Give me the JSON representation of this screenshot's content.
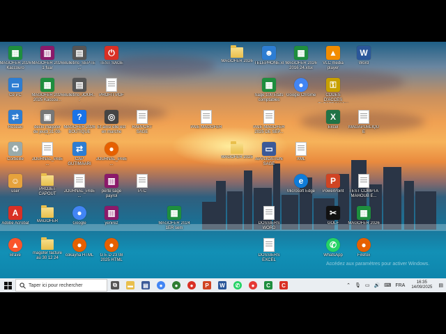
{
  "desktop": {
    "icons": [
      {
        "label": "MAGOFER 2026 Kaccouro",
        "kind": "sheet",
        "color": "#1e8e3e"
      },
      {
        "label": "MAGOFER 2026 1 fuar",
        "kind": "rar",
        "color": "#8b1a6a"
      },
      {
        "label": "Bulletins_SEPTE...",
        "kind": "file",
        "color": "#555"
      },
      {
        "label": "TEST SAGE",
        "kind": "app",
        "color": "#d93025"
      },
      {
        "label": "Ce PC",
        "kind": "pc",
        "color": "#2d7dd2"
      },
      {
        "label": "MAGOFER 2026 2025 Kaccou...",
        "kind": "sheet",
        "color": "#1e8e3e"
      },
      {
        "label": "Bulletins_JOUR...",
        "kind": "file",
        "color": "#555"
      },
      {
        "label": "PROFIT PDF",
        "kind": "doc",
        "color": "#aaa"
      },
      {
        "label": "Réseau",
        "kind": "net",
        "color": "#2d7dd2"
      },
      {
        "label": "déclo magofer de jeudi 31-09-26",
        "kind": "printer",
        "color": "#777"
      },
      {
        "label": "MAGOFER 2026 BOUTIQUE",
        "kind": "help",
        "color": "#1a73e8"
      },
      {
        "label": "Et ainsi elle est en marche",
        "kind": "app2",
        "color": "#444"
      },
      {
        "label": "RAPPORT SAGE",
        "kind": "doc",
        "color": "#aaa"
      },
      {
        "label": "Corbeille",
        "kind": "bin",
        "color": "#9aa"
      },
      {
        "label": "JOURNAL_PAIE...",
        "kind": "doc",
        "color": "#aaa"
      },
      {
        "label": "CAP GUTIMAARI",
        "kind": "net",
        "color": "#2d7dd2"
      },
      {
        "label": "JOURNAL_PAIE...",
        "kind": "firefox",
        "color": "#e66000"
      },
      {
        "label": "user",
        "kind": "user",
        "color": "#e6a23c"
      },
      {
        "label": "PROJET CAPOUT",
        "kind": "folder",
        "color": "#e9bf4c"
      },
      {
        "label": "JOURNAL_PAIE...",
        "kind": "doc",
        "color": "#aaa"
      },
      {
        "label": "perte sage payrol",
        "kind": "rar",
        "color": "#8b1a6a"
      },
      {
        "label": "PTC",
        "kind": "doc",
        "color": "#aaa"
      },
      {
        "label": "Adobe Acrobat",
        "kind": "pdf",
        "color": "#d93025"
      },
      {
        "label": "MAGOFER",
        "kind": "folder",
        "color": "#e9bf4c"
      },
      {
        "label": "Google",
        "kind": "chrome",
        "color": "#4285f4"
      },
      {
        "label": "yenirez",
        "kind": "rar",
        "color": "#8b1a6a"
      },
      {
        "label": "MAGOFER 2024 1ER sem",
        "kind": "sheet",
        "color": "#1e8e3e"
      },
      {
        "label": "Brave",
        "kind": "brave",
        "color": "#fb542b"
      },
      {
        "label": "magofer facture au 30 12 24",
        "kind": "folder",
        "color": "#e9bf4c"
      },
      {
        "label": "cokayna HTML",
        "kind": "firefox",
        "color": "#e66000"
      },
      {
        "label": "G E D 23 08 2025 HTML",
        "kind": "firefox",
        "color": "#e66000"
      },
      {
        "label": "MAGOFER 2026",
        "kind": "folder",
        "color": "#e9bf4c"
      },
      {
        "label": "TELEPHONE.xl",
        "kind": "people",
        "color": "#2d7dd2"
      },
      {
        "label": "MAGOFER 2026 2016 24.xlsx",
        "kind": "sheet",
        "color": "#1e8e3e"
      },
      {
        "label": "VLC media player",
        "kind": "vlc",
        "color": "#f28c00"
      },
      {
        "label": "Word",
        "kind": "word",
        "color": "#2b579a"
      },
      {
        "label": "Sage 100 Etats comptables",
        "kind": "sage",
        "color": "#1e8e3e"
      },
      {
        "label": "Google Chrome",
        "kind": "chrome",
        "color": "#4285f4"
      },
      {
        "label": "CODES D'ACCES ELECTRONIQUE",
        "kind": "key",
        "color": "#c8a000"
      },
      {
        "label": "PAIE MAGOFER",
        "kind": "doc",
        "color": "#aaa"
      },
      {
        "label": "PAIE MAGOFER 2025 DE SEP...",
        "kind": "doc",
        "color": "#aaa"
      },
      {
        "label": "Excel",
        "kind": "excel",
        "color": "#217346"
      },
      {
        "label": "MAGAPUBLIQUE",
        "kind": "doc",
        "color": "#aaa"
      },
      {
        "label": "MAGOFER 2025",
        "kind": "folder",
        "color": "#e9bf4c"
      },
      {
        "label": "APPLICATION SAGE",
        "kind": "monitor",
        "color": "#3b5998"
      },
      {
        "label": "XML",
        "kind": "doc",
        "color": "#aaa"
      },
      {
        "label": "Microsoft Edge",
        "kind": "edge",
        "color": "#0f7bd8"
      },
      {
        "label": "PowerPoint",
        "kind": "ppt",
        "color": "#d04423"
      },
      {
        "label": "TEST COMPTA MAHOUB E...",
        "kind": "doc",
        "color": "#aaa"
      },
      {
        "label": "DOSSIERS WORD",
        "kind": "doc",
        "color": "#aaa"
      },
      {
        "label": "GOLF",
        "kind": "capcut",
        "color": "#111"
      },
      {
        "label": "MAGOFER 2026",
        "kind": "sheet",
        "color": "#1e8e3e"
      },
      {
        "label": "DOSSIERS EXCEL",
        "kind": "doc",
        "color": "#aaa"
      },
      {
        "label": "WhatsApp",
        "kind": "whatsapp",
        "color": "#25d366"
      },
      {
        "label": "Firefox",
        "kind": "firefox",
        "color": "#e66000"
      }
    ],
    "watermark": "Accédez aux paramètres pour activer Windows."
  },
  "taskbar": {
    "search_placeholder": "Taper ici pour rechercher",
    "apps": [
      "task-view",
      "explorer",
      "calculator",
      "chrome",
      "chrome-profile",
      "chrome-profile-2",
      "powerpoint",
      "word",
      "whatsapp",
      "chrome-profile-3",
      "sage-green",
      "sage-red"
    ],
    "language": "FRA",
    "time": "16:35",
    "date": "14/09/2025"
  }
}
